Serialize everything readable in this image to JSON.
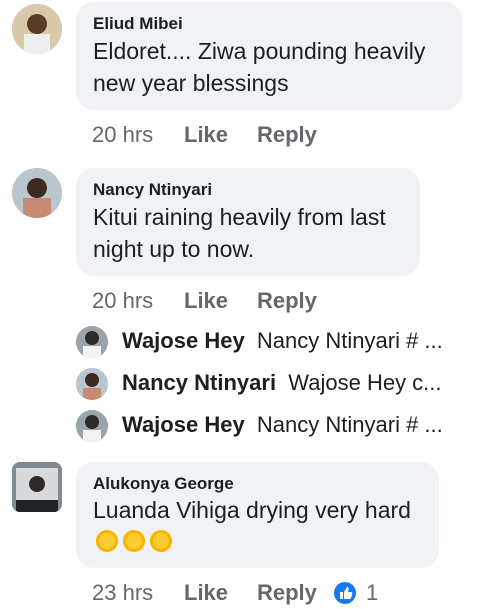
{
  "comments": [
    {
      "author": "Eliud Mibei",
      "text_lines": [
        "Eldoret.... Ziwa  pounding heavily",
        "new year blessings"
      ],
      "time": "20 hrs",
      "like": "Like",
      "reply": "Reply"
    },
    {
      "author": "Nancy Ntinyari",
      "text_lines": [
        "Kitui raining heavily from last",
        "night up to now."
      ],
      "time": "20 hrs",
      "like": "Like",
      "reply": "Reply",
      "replies": [
        {
          "name": "Wajose Hey",
          "preview": "Nancy Ntinyari # ..."
        },
        {
          "name": "Nancy Ntinyari",
          "preview": "Wajose Hey c..."
        },
        {
          "name": "Wajose Hey",
          "preview": "Nancy Ntinyari # ..."
        }
      ]
    },
    {
      "author": "Alukonya George",
      "text_lines": [
        "Luanda Vihiga drying very hard"
      ],
      "emoji_count": 3,
      "time": "23 hrs",
      "like": "Like",
      "reply": "Reply",
      "reaction_count": "1"
    }
  ],
  "colors": {
    "bubble": "#f0f2f5",
    "meta": "#65676b",
    "like_blue": "#1877f2"
  }
}
